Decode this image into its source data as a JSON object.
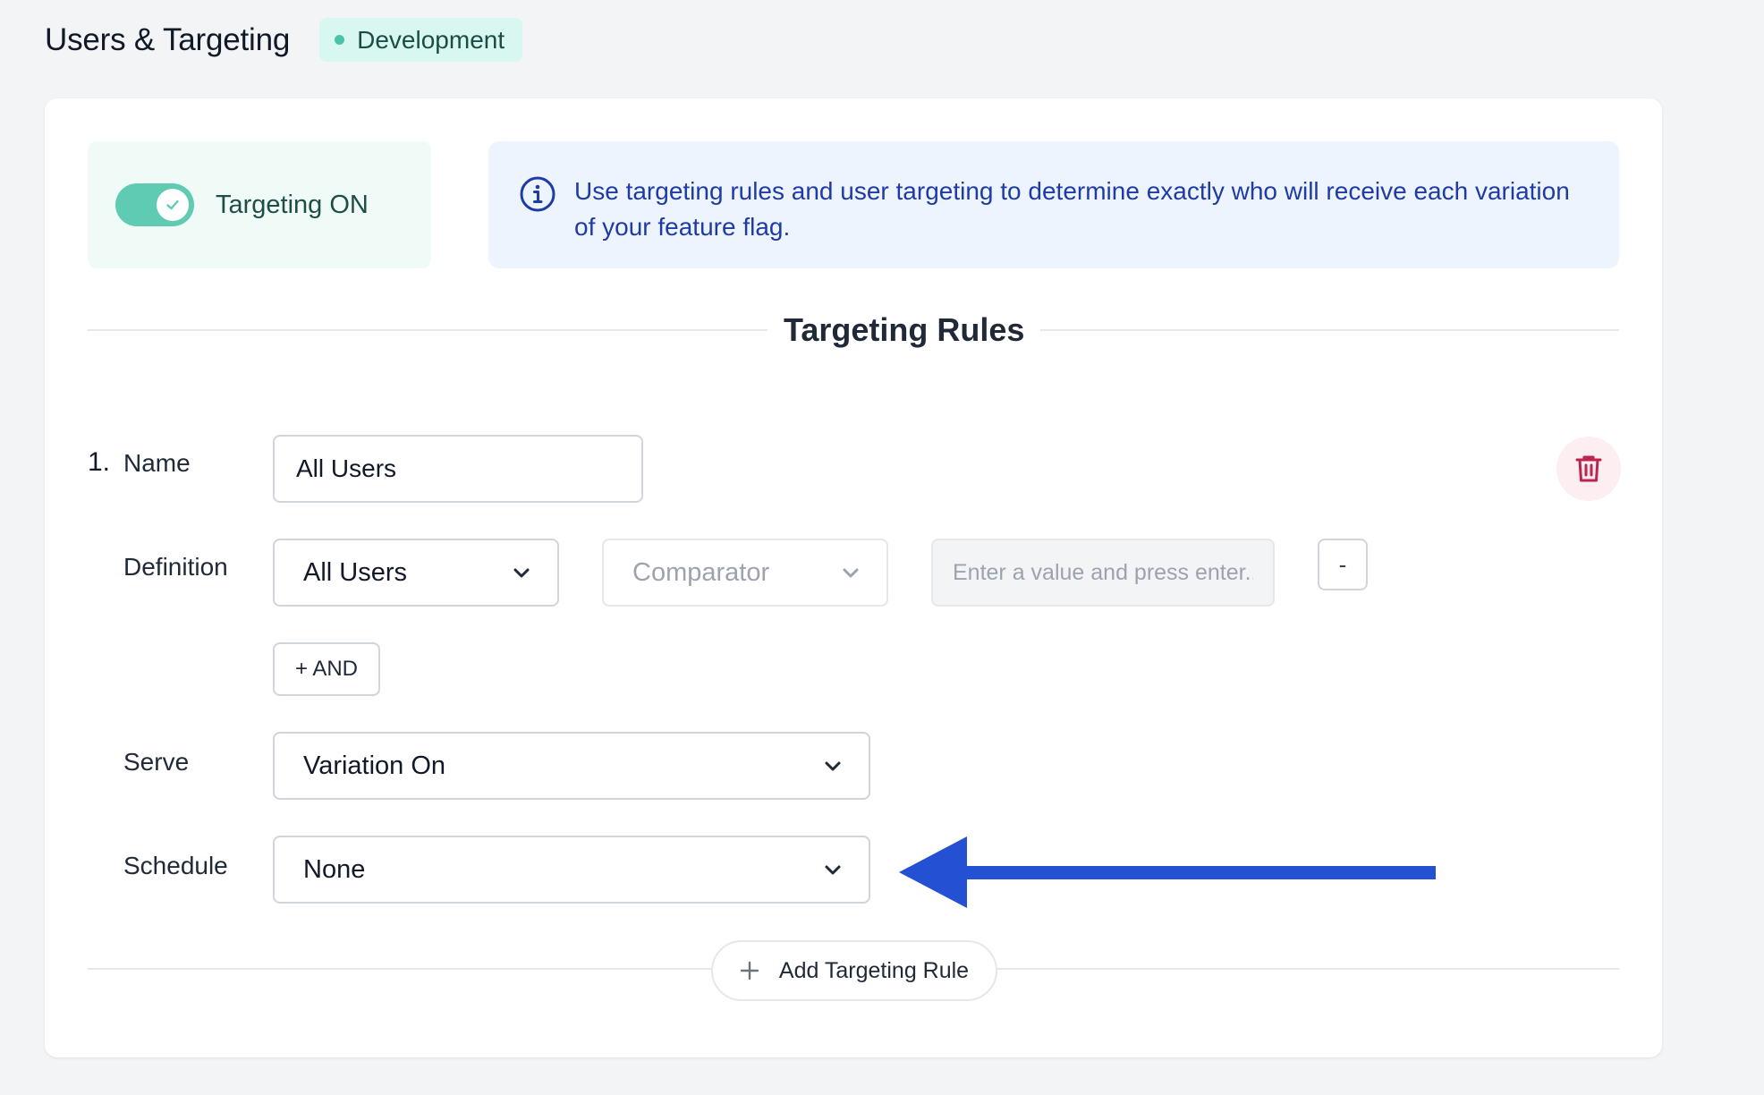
{
  "header": {
    "title": "Users & Targeting",
    "environment_badge": "Development"
  },
  "targeting_toggle": {
    "label": "Targeting ON",
    "state": "on",
    "color": "#5fcbb3"
  },
  "info_banner": {
    "icon": "info-icon",
    "text": "Use targeting rules and user targeting to determine exactly who will receive each variation of your feature flag."
  },
  "section_title": "Targeting Rules",
  "rule": {
    "number": "1.",
    "name_label": "Name",
    "name_value": "All Users",
    "definition_label": "Definition",
    "definition_select": "All Users",
    "comparator_placeholder": "Comparator",
    "value_placeholder": "Enter a value and press enter...",
    "remove_label": "-",
    "and_label": "+ AND",
    "serve_label": "Serve",
    "serve_value": "Variation On",
    "schedule_label": "Schedule",
    "schedule_value": "None",
    "delete_icon": "trash-icon"
  },
  "add_rule": {
    "icon": "plus-icon",
    "label": "Add Targeting Rule"
  },
  "annotation": {
    "type": "arrow",
    "points_to": "schedule-select",
    "color": "#2451d3"
  }
}
